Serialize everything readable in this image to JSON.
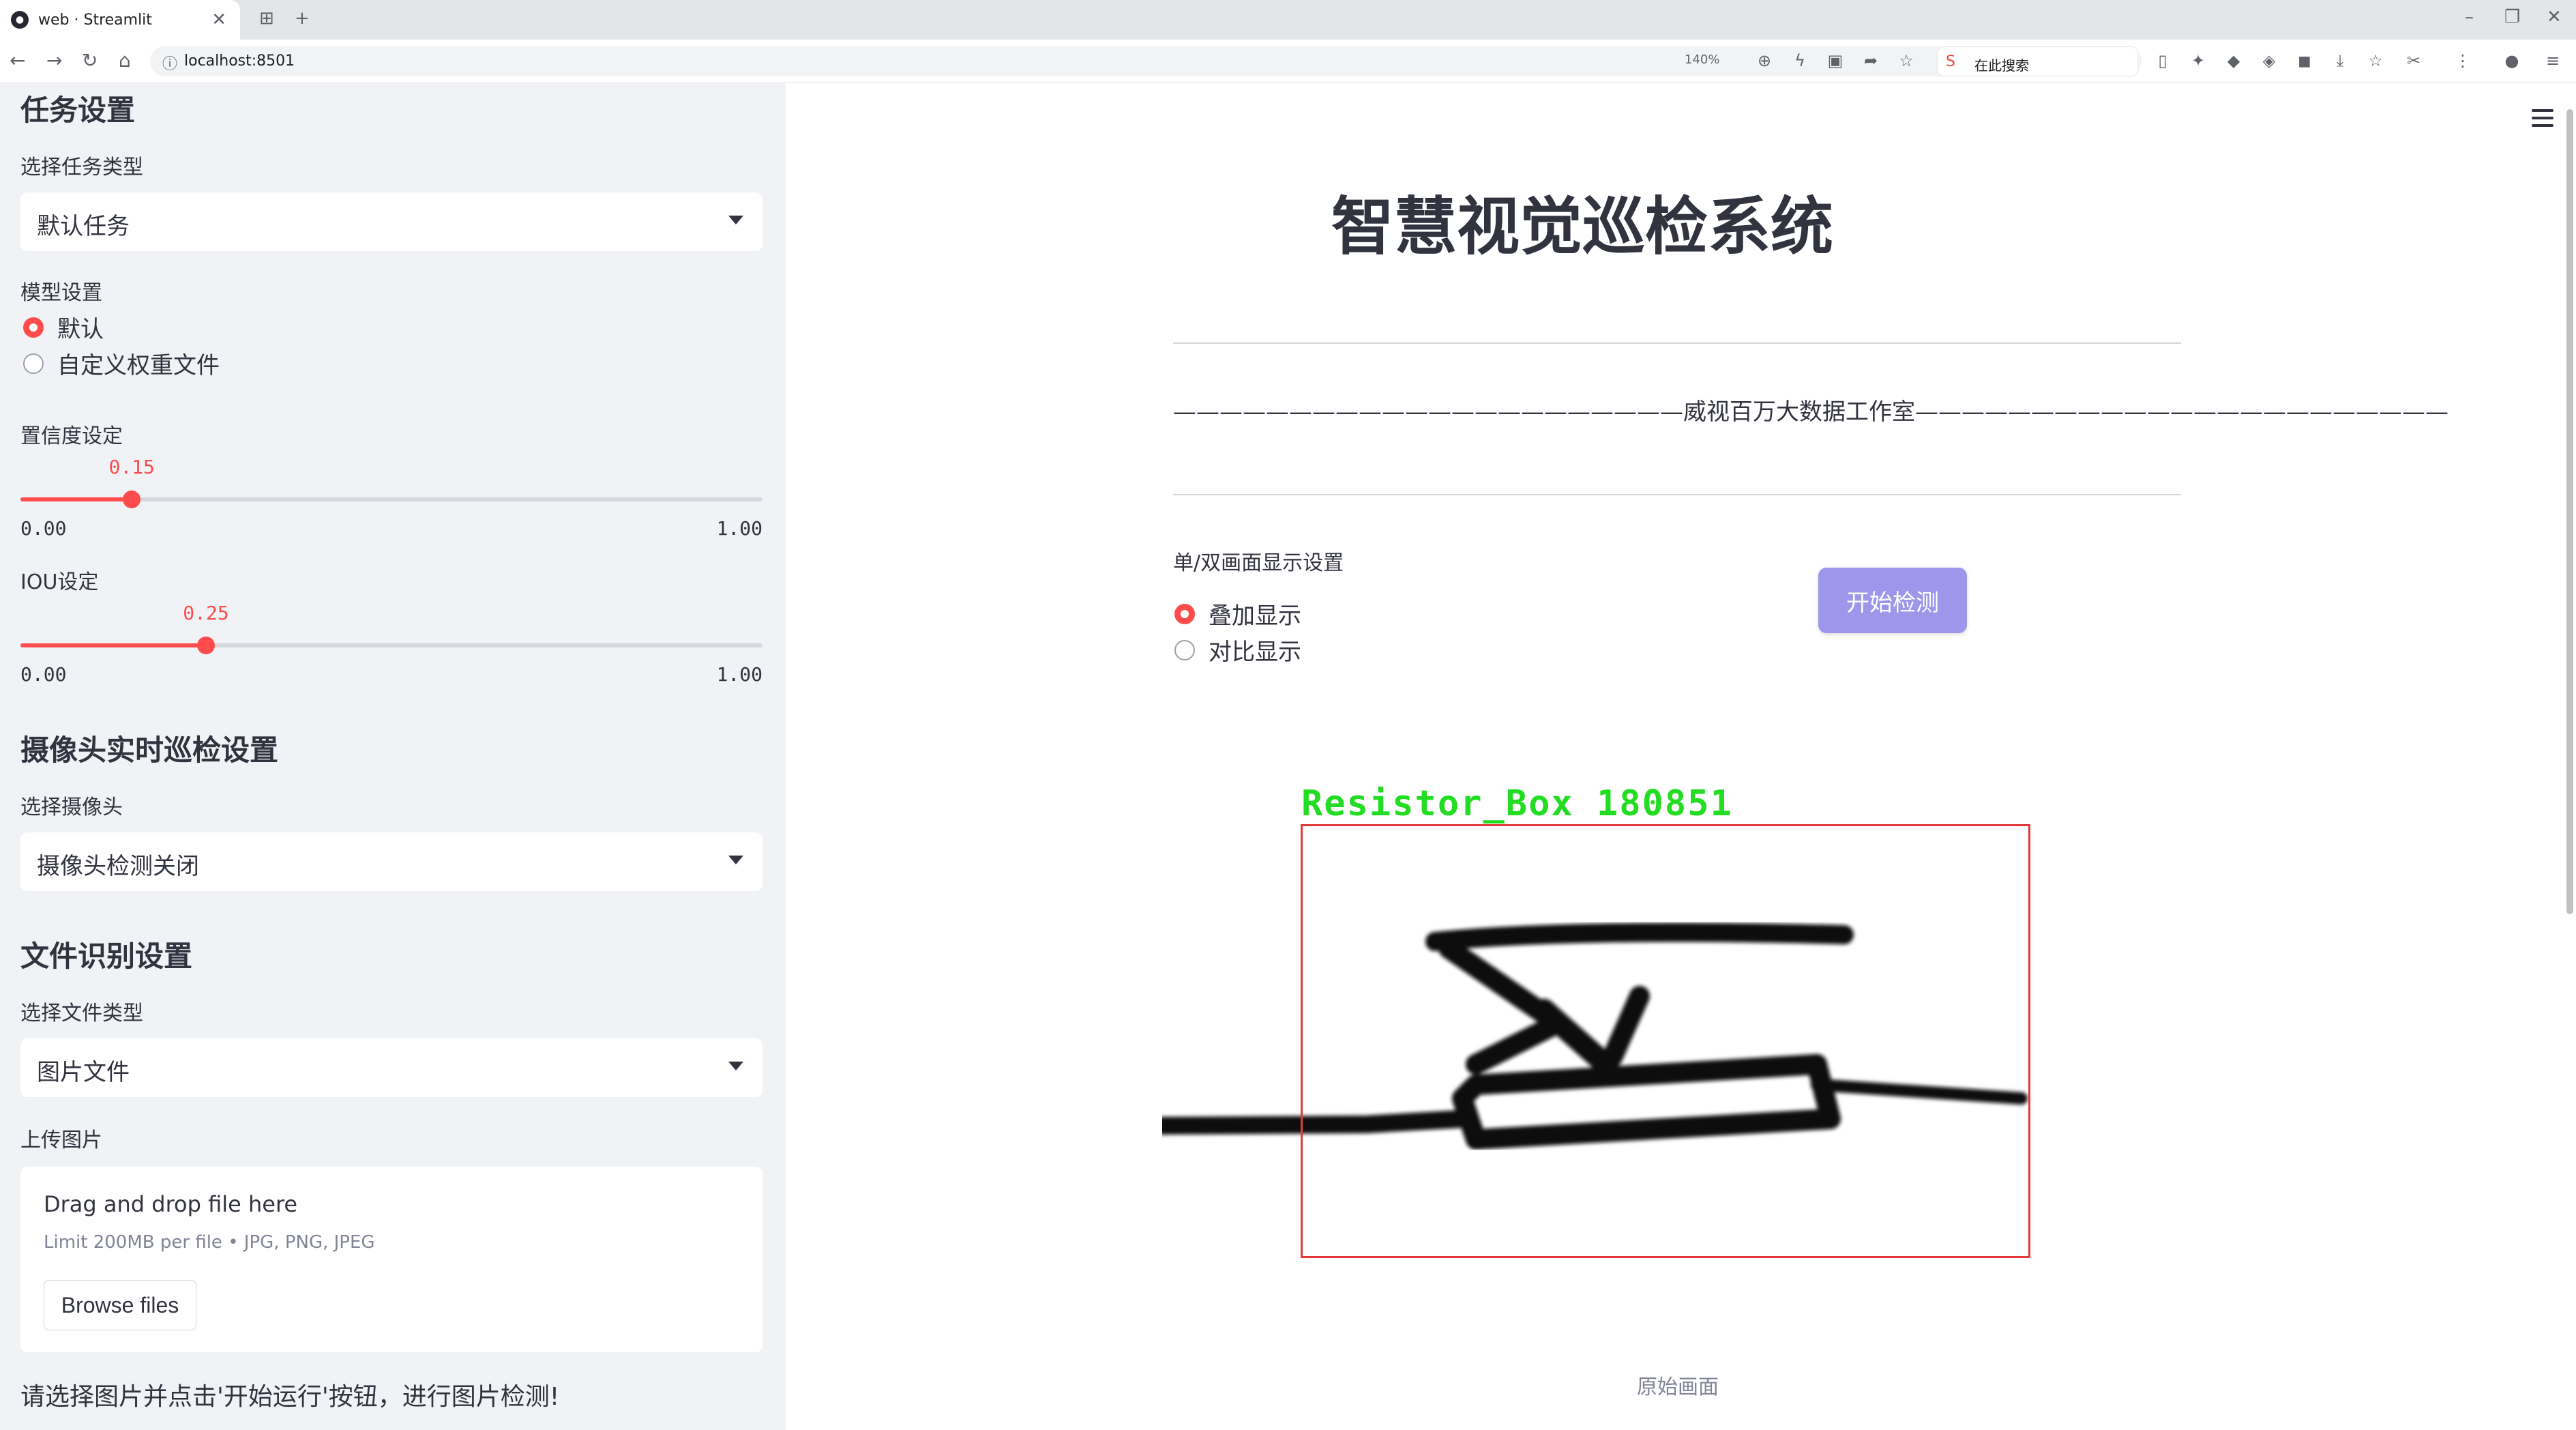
{
  "browser": {
    "tab_title": "web · Streamlit",
    "url": "localhost:8501",
    "zoom": "140%",
    "search_text": "在此搜索"
  },
  "sidebar": {
    "task_section": {
      "title": "任务设置",
      "type_label": "选择任务类型",
      "type_value": "默认任务"
    },
    "model_section": {
      "label": "模型设置",
      "options": [
        "默认",
        "自定义权重文件"
      ],
      "selected": "默认"
    },
    "confidence": {
      "label": "置信度设定",
      "value": "0.15",
      "value_fraction": 0.15,
      "min": "0.00",
      "max": "1.00"
    },
    "iou": {
      "label": "IOU设定",
      "value": "0.25",
      "value_fraction": 0.25,
      "min": "0.00",
      "max": "1.00"
    },
    "camera_section": {
      "title": "摄像头实时巡检设置",
      "label": "选择摄像头",
      "value": "摄像头检测关闭"
    },
    "file_section": {
      "title": "文件识别设置",
      "type_label": "选择文件类型",
      "type_value": "图片文件",
      "upload_label": "上传图片",
      "drag_text": "Drag and drop file here",
      "limit_text": "Limit 200MB per file • JPG, PNG, JPEG",
      "browse_label": "Browse files"
    },
    "hint": "请选择图片并点击'开始运行'按钮，进行图片检测!"
  },
  "main": {
    "title": "智慧视觉巡检系统",
    "subtitle": "——————————————————————威视百万大数据工作室———————————————————————",
    "display_label": "单/双画面显示设置",
    "display_options": [
      "叠加显示",
      "对比显示"
    ],
    "display_selected": "叠加显示",
    "start_button": "开始检测",
    "detection_label": "Resistor_Box 180851",
    "image_caption": "原始画面"
  },
  "colors": {
    "accent": "#ff4b4b",
    "button": "#9e96eb",
    "sidebar_bg": "#f0f2f6",
    "detection_box": "#e23b3b",
    "detection_text": "#22dd22"
  }
}
